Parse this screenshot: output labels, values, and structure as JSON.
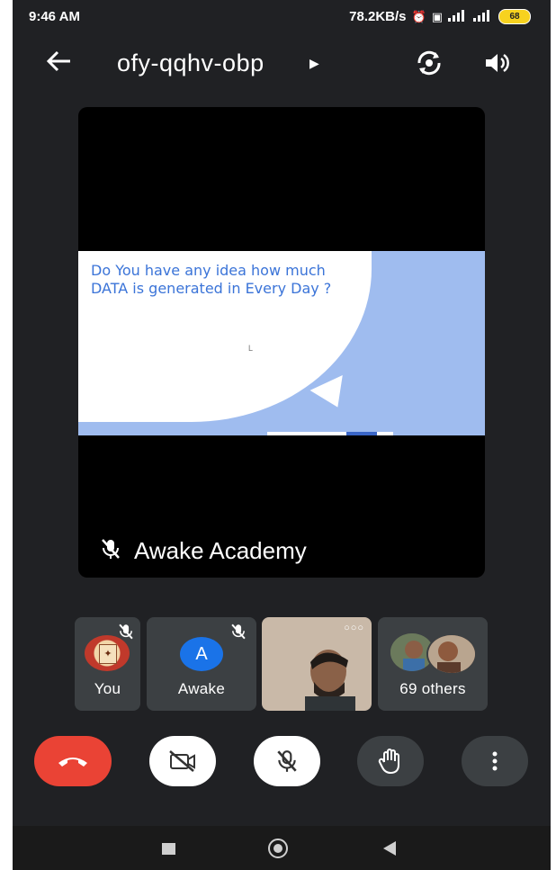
{
  "status_bar": {
    "time": "9:46 AM",
    "net_speed": "78.2KB/s",
    "battery": "68",
    "net_type": "4G"
  },
  "header": {
    "meeting_code": "ofy-qqhv-obp",
    "icons": [
      "back-arrow-icon",
      "caret-right-icon",
      "switch-camera-icon",
      "speaker-icon"
    ]
  },
  "main_tile": {
    "slide_text": "Do You have any idea how much DATA is generated in Every Day ?",
    "presenter_name": "Awake Academy",
    "presenter_muted": true
  },
  "participants": [
    {
      "label": "You",
      "muted": true
    },
    {
      "label": "Awake",
      "initial": "A",
      "muted": true
    },
    {
      "label": "",
      "video": true
    },
    {
      "label": "69 others"
    }
  ],
  "controls": [
    "end-call",
    "camera-off",
    "mic-off",
    "raise-hand",
    "more-options"
  ],
  "colors": {
    "background": "#202124",
    "tile": "#3c4043",
    "end_call": "#ea4335",
    "avatar_blue": "#1a73e8",
    "slide_text": "#3b74d8",
    "slide_bg": "#9fbcef"
  }
}
